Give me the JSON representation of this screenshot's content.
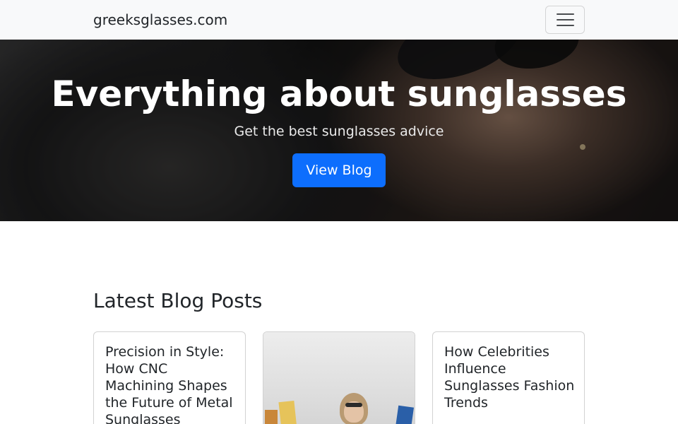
{
  "navbar": {
    "brand": "greeksglasses.com",
    "toggler_icon": "hamburger-menu-icon"
  },
  "hero": {
    "title": "Everything about sunglasses",
    "subtitle": "Get the best sunglasses advice",
    "button_label": "View Blog",
    "button_color": "#0d6efd"
  },
  "blog": {
    "heading": "Latest Blog Posts",
    "posts": [
      {
        "title": "Precision in Style: How CNC Machining Shapes the Future of Metal Sunglasses"
      },
      {
        "title": ""
      },
      {
        "title": "How Celebrities Influence Sunglasses Fashion Trends"
      }
    ]
  }
}
